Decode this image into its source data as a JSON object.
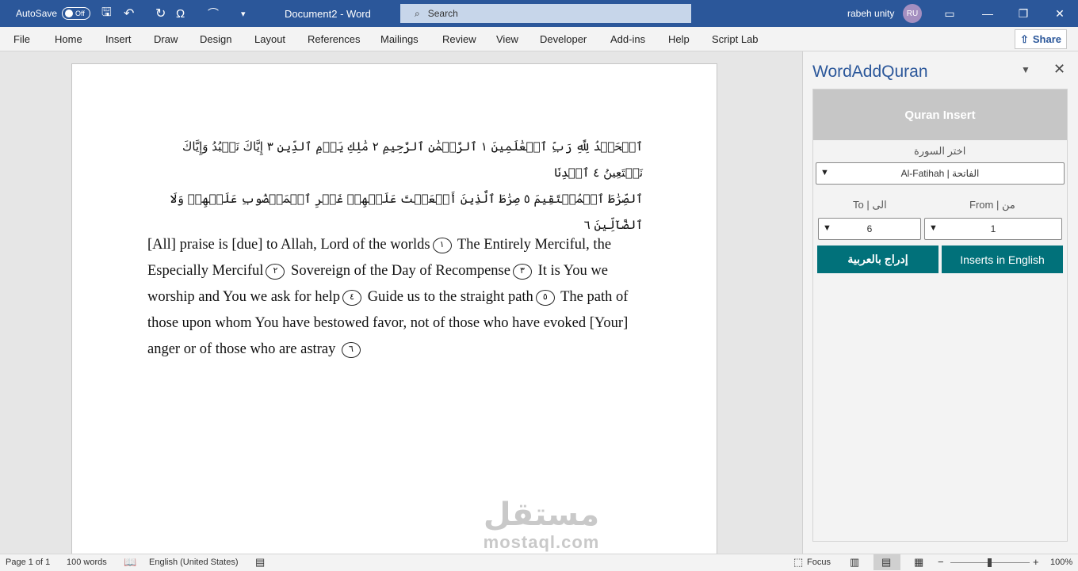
{
  "titlebar": {
    "autosave_label": "AutoSave",
    "autosave_state": "Off",
    "doc_title": "Document2  -  Word",
    "search_placeholder": "Search",
    "user_name": "rabeh unity",
    "user_initials": "RU"
  },
  "menu": [
    "File",
    "Home",
    "Insert",
    "Draw",
    "Design",
    "Layout",
    "References",
    "Mailings",
    "Review",
    "View",
    "Developer",
    "Add-ins",
    "Help",
    "Script Lab"
  ],
  "share_label": "Share",
  "document": {
    "arabic_line1": "ٱلۡحَمۡدُ لِلَّهِ رَبِّ ٱلۡعَٰلَمِينَ ١ ٱلرَّحۡمَٰنِ ٱلرَّحِيمِ ٢ مَٰلِكِ يَوۡمِ ٱلدِّينِ ٣ إِيَّاكَ نَعۡبُدُ وَإِيَّاكَ نَسۡتَعِينُ ٤ ٱهۡدِنَا",
    "arabic_line2": "ٱلصِّرَٰطَ ٱلۡمُسۡتَقِيمَ ٥ صِرَٰطَ ٱلَّذِينَ أَنۡعَمۡتَ عَلَيۡهِمۡ غَيۡرِ ٱلۡمَغۡضُوبِ عَلَيۡهِمۡ وَلَا ٱلضَّآلِّينَ ٦",
    "english": [
      {
        "text": "[All] praise is [due] to Allah, Lord of the worlds",
        "num": "١"
      },
      {
        "text": " The Entirely Merciful, the Especially Merciful",
        "num": "٢"
      },
      {
        "text": " Sovereign of the Day of Recompense",
        "num": "٣"
      },
      {
        "text": " It is You we worship and You we ask for help",
        "num": "٤"
      },
      {
        "text": " Guide us to the straight path",
        "num": "٥"
      },
      {
        "text": " The path of those upon whom You have bestowed favor, not of those who have evoked [Your] anger or of those who are astray ",
        "num": "٦"
      }
    ]
  },
  "watermark": {
    "arabic": "مستقل",
    "latin": "mostaql.com"
  },
  "pane": {
    "title": "WordAddQuran",
    "header": "Quran Insert",
    "surah_label": "اختر السورة",
    "surah_value": "Al-Fatihah | الفاتحة",
    "to_label": "To | الى",
    "from_label": "From | من",
    "to_value": "6",
    "from_value": "1",
    "btn_arabic": "إدراج بالعربية",
    "btn_english": "Inserts in English"
  },
  "status": {
    "page": "Page 1 of 1",
    "words": "100 words",
    "language": "English (United States)",
    "focus": "Focus",
    "zoom": "100%"
  },
  "colors": {
    "word_blue": "#2b579a",
    "teal": "#01717a"
  }
}
